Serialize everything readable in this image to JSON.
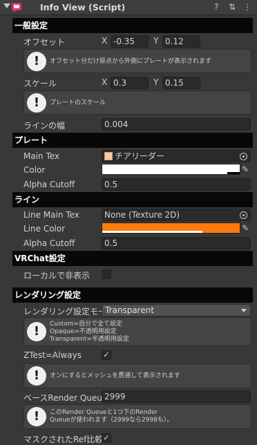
{
  "header": {
    "title": "Info View (Script)",
    "help_icon": "?",
    "settings_icon": "⇅",
    "menu_icon": "⋮",
    "accent": "#e0315b"
  },
  "general": {
    "section_title": "一般設定",
    "offset_label": "オフセット",
    "offset_x_axis": "X",
    "offset_x": "-0.35",
    "offset_y_axis": "Y",
    "offset_y": "0.12",
    "offset_help": "オフセット分だけ原点から外側にプレートが表示されます",
    "scale_label": "スケール",
    "scale_x_axis": "X",
    "scale_x": "0.3",
    "scale_y_axis": "Y",
    "scale_y": "0.15",
    "scale_help": "プレートのスケール",
    "line_width_label": "ラインの幅",
    "line_width": "0.004"
  },
  "plate": {
    "section_title": "プレート",
    "main_tex_label": "Main Tex",
    "main_tex_value": "チアリーダー",
    "color_label": "Color",
    "color_value": "#ffffff",
    "alpha_label": "Alpha Cutoff",
    "alpha_value": "0.5"
  },
  "line": {
    "section_title": "ライン",
    "main_tex_label": "Line Main Tex",
    "main_tex_value": "None (Texture 2D)",
    "color_label": "Line Color",
    "color_value": "#ff7a0a",
    "alpha_label": "Alpha Cutoff",
    "alpha_value": "0.5"
  },
  "vrchat": {
    "section_title": "VRChat設定",
    "local_hide_label": "ローカルで非表示",
    "local_hide_checked": false
  },
  "render": {
    "section_title": "レンダリング設定",
    "mode_label": "レンダリング設定モード",
    "mode_value": "Transparent",
    "mode_help": "Custom=自分で全て設定\nOpaque=不透明用設定\nTransparent=半透明用設定",
    "ztest_label": "ZTest=Always",
    "ztest_check": "✓",
    "ztest_help": "オンにするとメッシュを貫通して表示されます",
    "queue_label": "ベースRender Queue",
    "queue_value": "2999",
    "queue_help": "このRender Queueと1つ下のRender\nQueueが使われます（2999なら2998も）。",
    "masked_label": "マスクされたRef比較",
    "masked_check": "✓"
  }
}
